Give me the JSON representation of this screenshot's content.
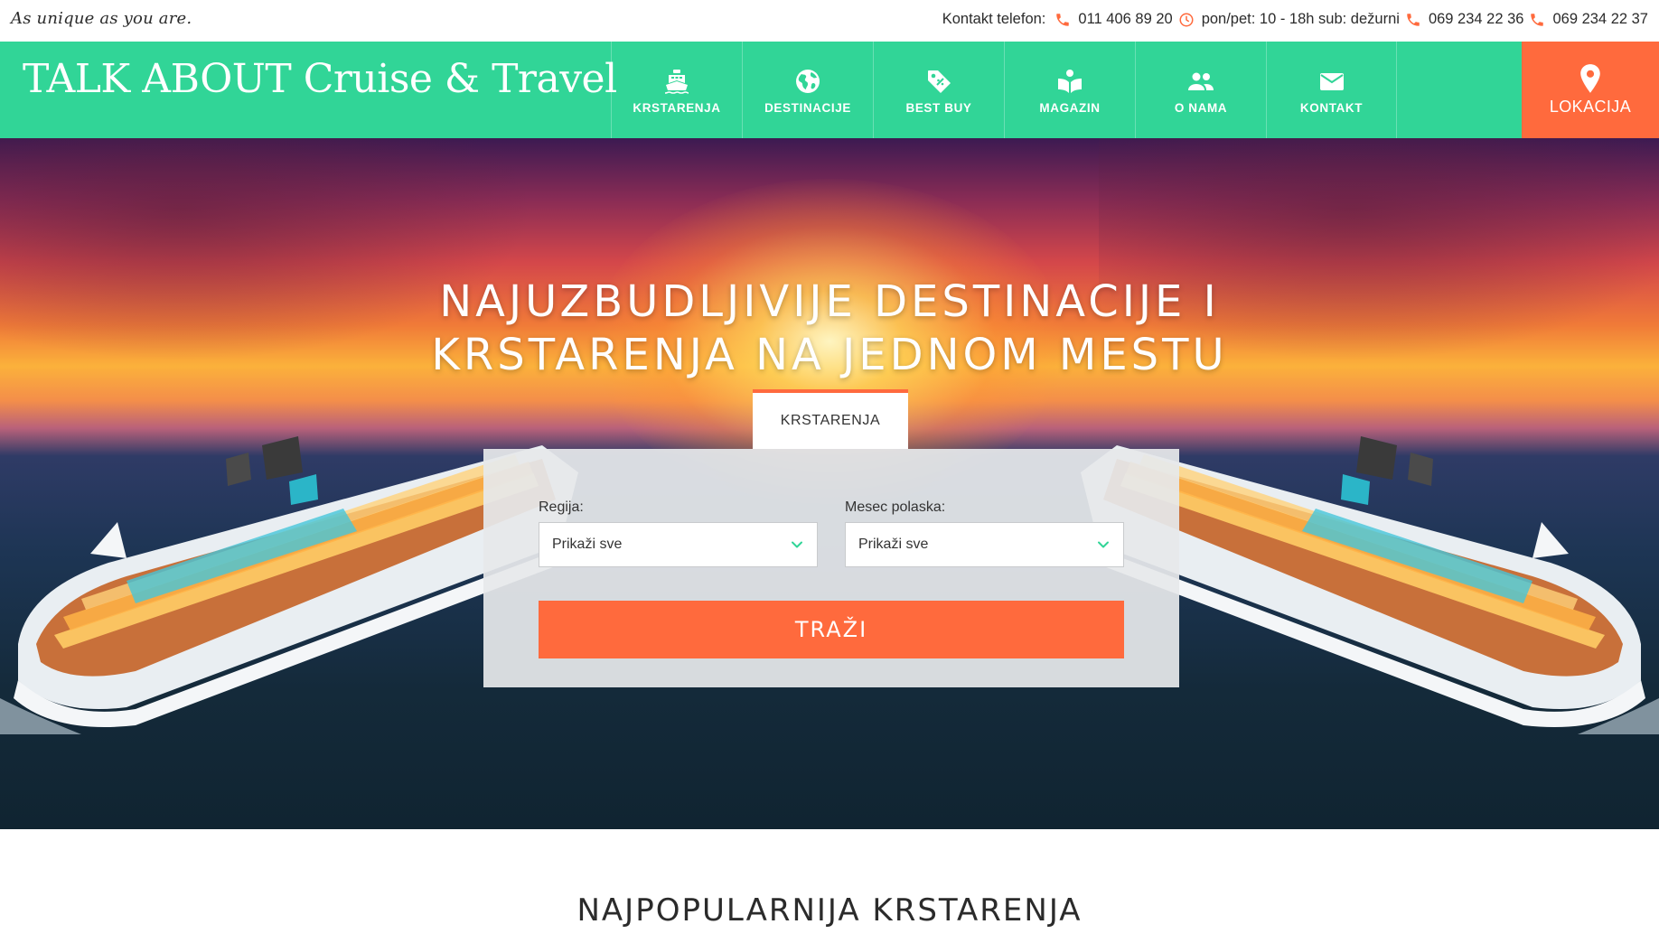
{
  "topbar": {
    "tagline": "As unique as you are.",
    "contact_label": "Kontakt telefon:",
    "phone_1": "011 406 89 20",
    "hours": "pon/pet: 10 - 18h sub: dežurni",
    "phone_2": "069 234 22 36",
    "phone_3": "069 234 22 37",
    "accent_color": "#ff6a3d"
  },
  "navbar": {
    "logo": "TALK ABOUT Cruise & Travel",
    "bg_color": "#31d597",
    "items": [
      {
        "label": "KRSTARENJA",
        "icon": "ship-icon"
      },
      {
        "label": "DESTINACIJE",
        "icon": "globe-icon"
      },
      {
        "label": "BEST BUY",
        "icon": "tag-icon"
      },
      {
        "label": "MAGAZIN",
        "icon": "book-icon"
      },
      {
        "label": "O NAMA",
        "icon": "people-icon"
      },
      {
        "label": "KONTAKT",
        "icon": "mail-icon"
      }
    ],
    "location": {
      "label": "LOKACIJA",
      "icon": "location-pin-icon",
      "bg_color": "#ff6a3d"
    }
  },
  "hero": {
    "title_line_1": "NAJUZBUDLJIVIJE DESTINACIJE I",
    "title_line_2": "KRSTARENJA NA JEDNOM MESTU",
    "tab_label": "KRSTARENJA",
    "search": {
      "region_label": "Regija:",
      "region_value": "Prikaži sve",
      "month_label": "Mesec polaska:",
      "month_value": "Prikaži sve",
      "button_label": "TRAŽI"
    }
  },
  "section": {
    "popular_title": "NAJPOPULARNIJA KRSTARENJA"
  }
}
